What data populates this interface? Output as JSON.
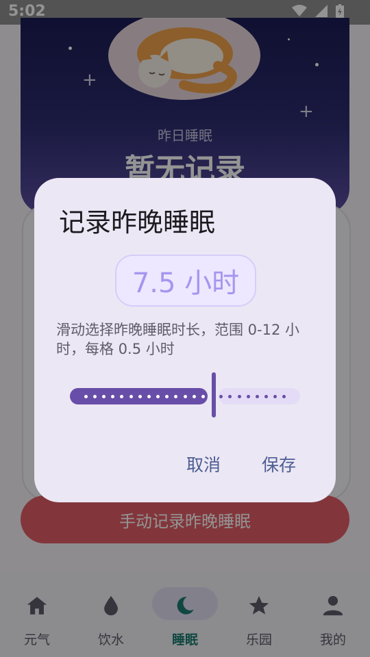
{
  "status": {
    "time": "5:02"
  },
  "hero": {
    "label": "昨日睡眠",
    "value": "暂无记录"
  },
  "record_button": "手动记录昨晚睡眠",
  "nav": [
    {
      "label": "元气",
      "icon": "home-icon",
      "active": false
    },
    {
      "label": "饮水",
      "icon": "water-drop-icon",
      "active": false
    },
    {
      "label": "睡眠",
      "icon": "moon-icon",
      "active": true
    },
    {
      "label": "乐园",
      "icon": "star-icon",
      "active": false
    },
    {
      "label": "我的",
      "icon": "person-icon",
      "active": false
    }
  ],
  "dialog": {
    "title": "记录昨晚睡眠",
    "value": "7.5 小时",
    "description": "滑动选择昨晚睡眠时长，范围 0-12 小时，每格 0.5 小时",
    "slider": {
      "min": 0,
      "max": 12,
      "step": 0.5,
      "current": 7.5
    },
    "cancel": "取消",
    "save": "保存"
  },
  "colors": {
    "accent": "#684ea8",
    "record_button": "#e05d67",
    "nav_active": "#1c7c70"
  }
}
